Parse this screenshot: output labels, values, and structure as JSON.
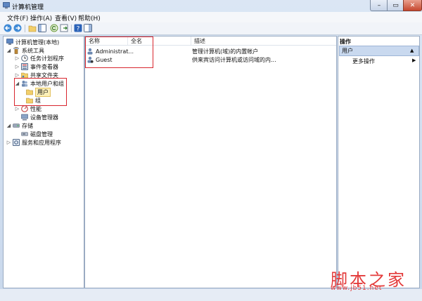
{
  "window": {
    "title": "计算机管理",
    "close_glyph": "✕",
    "max_glyph": "▭",
    "min_glyph": "–"
  },
  "menu": [
    "文件(F)",
    "操作(A)",
    "查看(V)",
    "帮助(H)"
  ],
  "tree": {
    "root": "计算机管理(本地)",
    "system_tools": "系统工具",
    "task_scheduler": "任务计划程序",
    "event_viewer": "事件查看器",
    "shared_folders": "共享文件夹",
    "local_users_groups": "本地用户和组",
    "users": "用户",
    "groups": "组",
    "performance": "性能",
    "device_manager": "设备管理器",
    "storage": "存储",
    "disk_management": "磁盘管理",
    "services_apps": "服务和应用程序"
  },
  "list": {
    "headers": {
      "name": "名称",
      "fullname": "全名",
      "desc": "描述"
    },
    "rows": [
      {
        "name": "Administrat...",
        "fullname": "",
        "desc": "管理计算机(域)的内置帐户"
      },
      {
        "name": "Guest",
        "fullname": "",
        "desc": "供来宾访问计算机或访问域的内..."
      }
    ]
  },
  "actions": {
    "header": "操作",
    "selected": "用户",
    "more": "更多操作",
    "collapse_glyph": "▲",
    "more_glyph": "▶"
  },
  "watermark": {
    "text": "脚本之家",
    "url": "www.jb51.net"
  },
  "colors": {
    "highlight_box": "#d8262e",
    "selection": "#c9d9ef",
    "folder": "#f2cf6b"
  }
}
